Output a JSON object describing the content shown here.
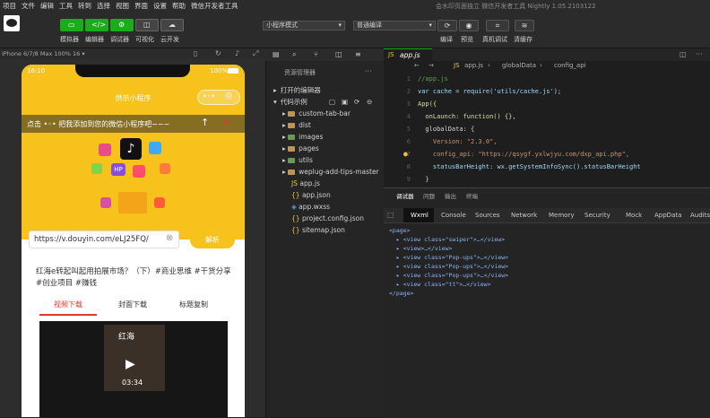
{
  "menubar": {
    "items": [
      "项目",
      "文件",
      "编辑",
      "工具",
      "转到",
      "选择",
      "视图",
      "界面",
      "设置",
      "帮助",
      "微信开发者工具"
    ],
    "title": "会水印页面独立   微信开发者工具 Nightly 1.05.2103122"
  },
  "toolbar": {
    "buttons": [
      {
        "label": "模拟器"
      },
      {
        "label": "编辑器"
      },
      {
        "label": "调试器"
      },
      {
        "label": "可视化"
      },
      {
        "label": "云开发"
      }
    ],
    "mode_select": "小程序模式",
    "compile_select": "普通编译",
    "right_buttons": [
      {
        "label": "编译"
      },
      {
        "label": "预览"
      },
      {
        "label": "真机调试"
      },
      {
        "label": "清缓存"
      }
    ]
  },
  "simulator": {
    "device": "iPhone 6/7/8 Max 100% 16 ▾",
    "status_time": "16:10",
    "status_battery": "100%",
    "nav_title": "供示小程序",
    "banner_text": "点击 •◦• 把我添加到您的微信小程序吧~~~",
    "url_value": "https://v.douyin.com/eLJ25FQ/",
    "parse_button": "解析",
    "result_title": "红海e转起叫起用拍展市场？（下）#商业思维 #干货分享 #创业项目 #赚钱",
    "tabs": [
      "视频下载",
      "封面下载",
      "标题复制"
    ],
    "video_overlay": "红海",
    "video_duration": "03:34"
  },
  "filepanel": {
    "header": "资源管理器",
    "open_editors": "打开的编辑器",
    "project": "代码示例",
    "folders": [
      "custom-tab-bar",
      "dist",
      "images",
      "pages",
      "utils",
      "weplug-add-tips-master"
    ],
    "files": [
      "app.js",
      "app.json",
      "app.wxss",
      "project.config.json",
      "sitemap.json"
    ]
  },
  "editor": {
    "tab": "app.js",
    "breadcrumb": [
      "app.js",
      "globalData",
      "config_api"
    ],
    "lines": [
      {
        "n": "1",
        "text": "//app.js"
      },
      {
        "n": "2",
        "text": "var cache = require('utils/cache.js');"
      },
      {
        "n": "3",
        "text": "App({"
      },
      {
        "n": "4",
        "text": "  onLaunch: function() {},"
      },
      {
        "n": "5",
        "text": "  globalData: {"
      },
      {
        "n": "6",
        "text": "    Version: \"2.3.0\","
      },
      {
        "n": "7",
        "text": "    config_api: \"https://qsygf.yxlwjyu.com/dxp_api.php\","
      },
      {
        "n": "8",
        "text": "    statusBarHeight: wx.getSystemInfoSync().statusBarHeight"
      },
      {
        "n": "9",
        "text": "  }"
      }
    ]
  },
  "devtools": {
    "top_tabs": [
      "调试器",
      "问题",
      "输出",
      "终端"
    ],
    "tabs": [
      "Wxml",
      "Console",
      "Sources",
      "Network",
      "Memory",
      "Security",
      "Mock",
      "AppData",
      "Audits"
    ],
    "tree": [
      "<page>",
      "  ▸ <view class=\"swiper\">…</view>",
      "  ▸ <view>…</view>",
      "  ▸ <view class=\"Pop-ups\">…</view>",
      "  ▸ <view class=\"Pop-ups\">…</view>",
      "  ▸ <view class=\"Pop-ups\">…</view>",
      "  ▸ <view class=\"tt\">…</view>",
      "</page>"
    ]
  },
  "colors": {
    "accent_green": "#1aad19",
    "yellow": "#f7c21c",
    "banner_red": "#e03a2f"
  }
}
